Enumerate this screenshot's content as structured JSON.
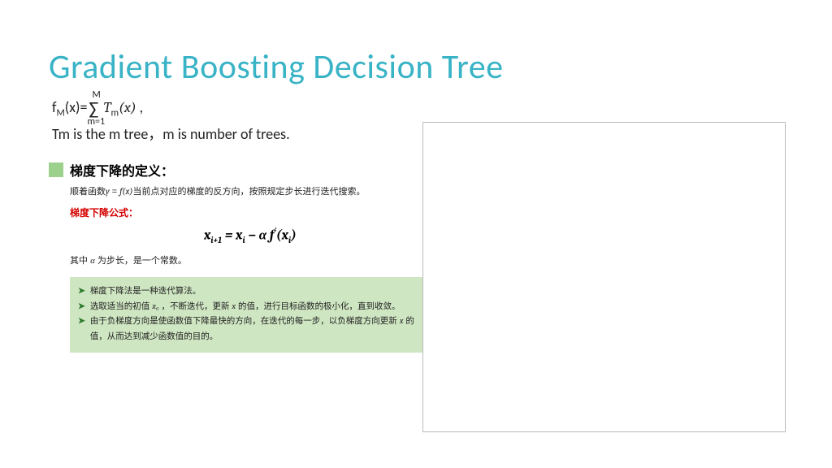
{
  "slide": {
    "title": "Gradient Boosting Decision Tree",
    "formula": {
      "lhs_f": "f",
      "lhs_sub": "M",
      "lhs_arg": "(x)=",
      "sigma": "∑",
      "sigma_lower": "m=1",
      "sigma_upper": "M",
      "term_T": "T",
      "term_sub": "m",
      "term_arg": "(x)",
      "trailing": "  ,"
    },
    "description": "Tm is the m tree，m is number of trees.",
    "definition": {
      "heading": "梯度下降的定义：",
      "line1_pre": "顺着函数",
      "line1_func_y": "y",
      "line1_eq": " = ",
      "line1_func_f": "f(x)",
      "line1_post": "当前点对应的梯度的反方向，按照规定步长进行迭代搜索。",
      "red_label": "梯度下降公式：",
      "gd_formula": {
        "x1": "x",
        "i1": "i+1",
        "eq": " = ",
        "x2": "x",
        "i2": "i",
        "minus": " − α f",
        "prime": "′",
        "open": "(x",
        "i3": "i",
        "close": ")"
      },
      "note_pre": "其中 ",
      "note_alpha": "α",
      "note_post": " 为步长，是一个常数。"
    },
    "bullets": {
      "b1": "梯度下降法是一种迭代算法。",
      "b2_pre": "选取适当的初值 ",
      "b2_x0": "x₀",
      "b2_mid": " ，不断迭代，更新 ",
      "b2_x": "x",
      "b2_post": " 的值，进行目标函数的极小化，直到收敛。",
      "b3_pre": "由于负梯度方向是使函数值下降最快的方向，在迭代的每一步，以负梯度方向更新 ",
      "b3_x": "x",
      "b3_post": " 的值，从而达到减少函数值的目的。"
    }
  }
}
